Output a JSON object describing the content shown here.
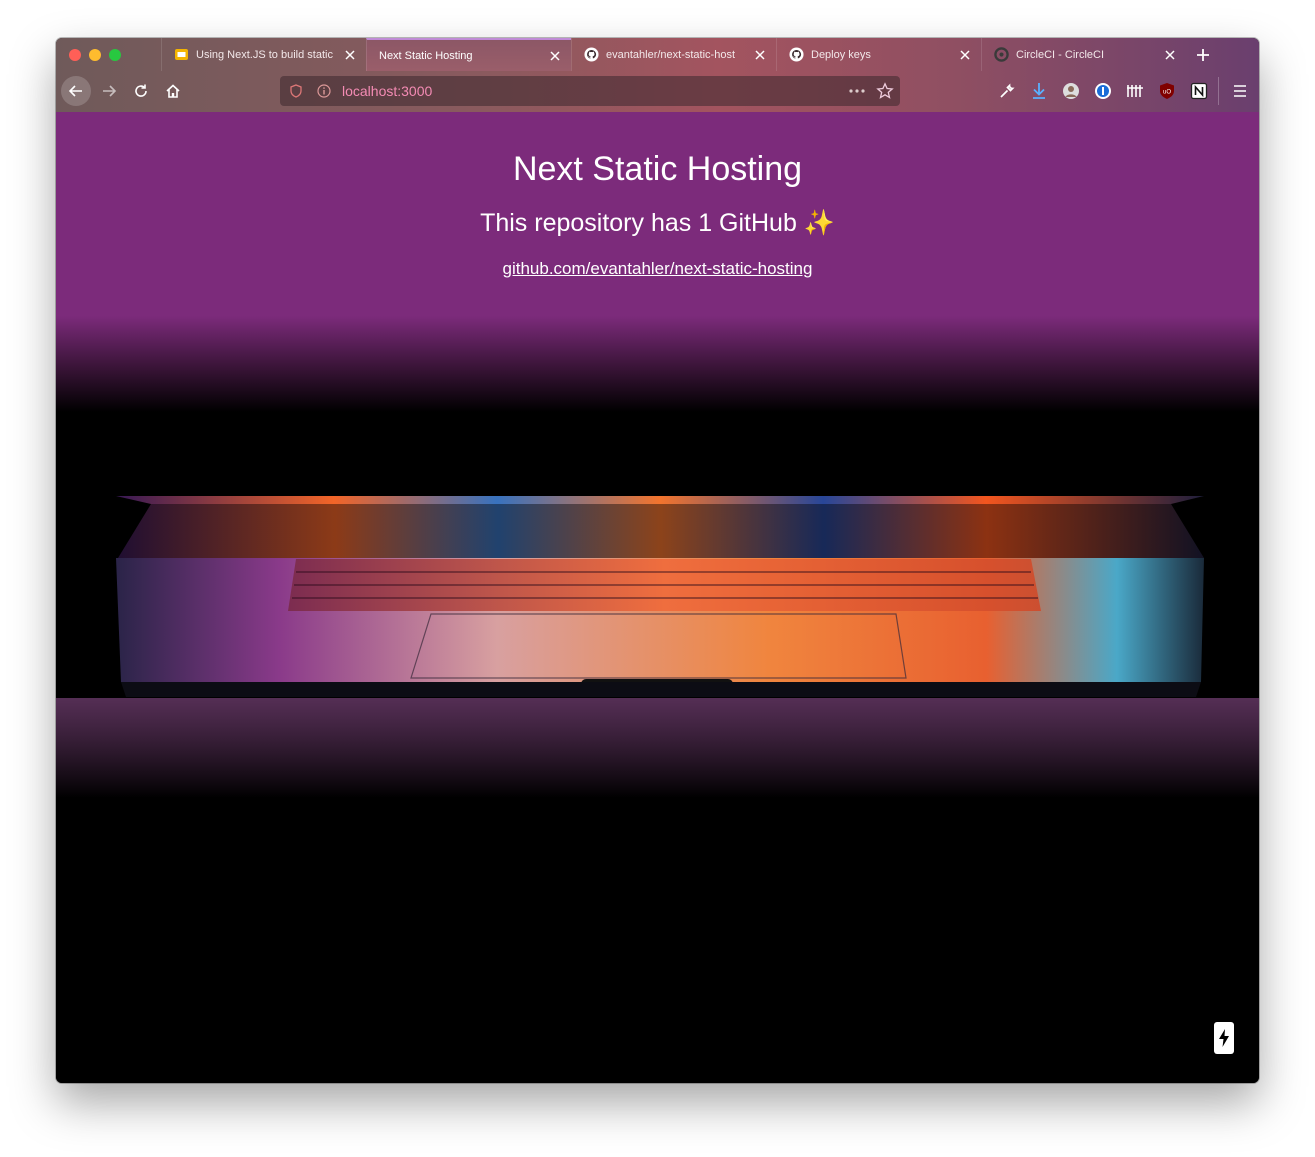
{
  "browser": {
    "tabs": [
      {
        "label": "Using Next.JS to build static",
        "favicon": "slides-icon",
        "active": false
      },
      {
        "label": "Next Static Hosting",
        "favicon": "",
        "active": true
      },
      {
        "label": "evantahler/next-static-host",
        "favicon": "github-icon",
        "active": false
      },
      {
        "label": "Deploy keys",
        "favicon": "github-icon",
        "active": false
      },
      {
        "label": "CircleCI - CircleCI",
        "favicon": "circleci-icon",
        "active": false
      }
    ],
    "url": "localhost:3000",
    "extensions": [
      "wrench-icon",
      "download-icon",
      "avatar-icon",
      "password-manager-icon",
      "bars-icon",
      "ublock-icon",
      "notion-icon"
    ]
  },
  "page": {
    "title": "Next Static Hosting",
    "subtitle": "This repository has 1 GitHub ✨",
    "link": "github.com/evantahler/next-static-hosting"
  },
  "colors": {
    "hero": "#7c2b7b",
    "url_text": "#f48bb4",
    "background": "#000000"
  }
}
